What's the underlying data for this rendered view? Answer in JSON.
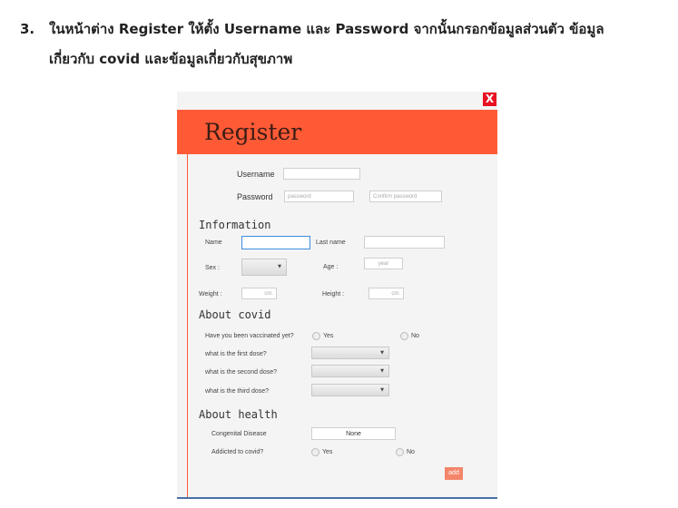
{
  "instruction": {
    "number": "3.",
    "line1": "ในหน้าต่าง Register ให้ตั้ง Username และ Password จากนั้นกรอกข้อมูลส่วนตัว ข้อมูล",
    "line2": "เกี่ยวกับ covid และข้อมูลเกี่ยวกับสุขภาพ"
  },
  "window": {
    "close_symbol": "X",
    "title": "Register"
  },
  "account": {
    "username_label": "Username",
    "password_label": "Password",
    "password_placeholder": "password",
    "confirm_placeholder": "Confirm password"
  },
  "information": {
    "heading": "Information",
    "name_label": "Name",
    "lastname_label": "Last name",
    "sex_label": "Sex    :",
    "age_label": "Age   :",
    "age_placeholder": "year",
    "weight_label": "Weight   :",
    "weight_placeholder": "cm.",
    "height_label": "Height    :",
    "height_placeholder": "cm."
  },
  "covid": {
    "heading": "About covid",
    "vaccinated_question": "Have you been vaccinated yet?",
    "yes_label": "Yes",
    "no_label": "No",
    "first_dose": "what is the first dose?",
    "second_dose": "what is the second dose?",
    "third_dose": "what is the third dose?"
  },
  "health": {
    "heading": "About health",
    "congenital_label": "Congenital Disease",
    "congenital_value": "None",
    "addicted_question": "Addicted to covid?",
    "yes_label": "Yes",
    "no_label": "No"
  },
  "add_button": "add",
  "colors": {
    "accent": "#ff5a36",
    "close": "#e81123",
    "add_button": "#f4856a"
  }
}
